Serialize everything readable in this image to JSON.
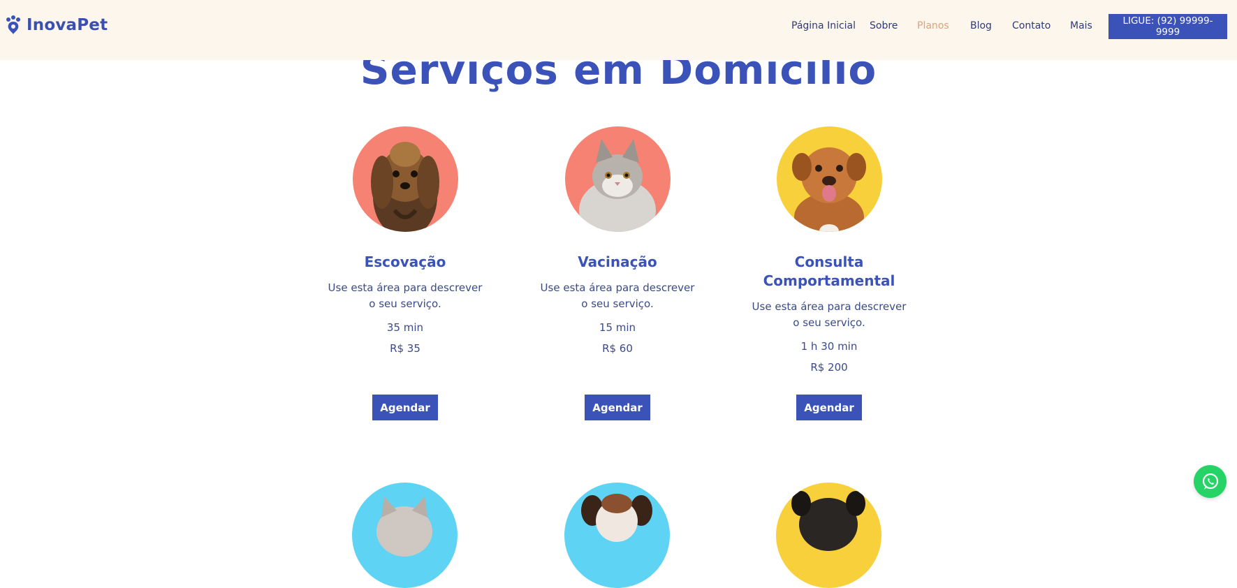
{
  "brand": {
    "name": "InovaPet",
    "icon": "paw-icon",
    "color": "#3b53b8"
  },
  "nav": {
    "items": [
      {
        "label": "Página Inicial"
      },
      {
        "label": "Sobre"
      },
      {
        "label": "Planos",
        "active": true
      },
      {
        "label": "Blog"
      },
      {
        "label": "Contato"
      },
      {
        "label": "Mais"
      }
    ],
    "call_button": "LIGUE: (92) 99999-9999"
  },
  "page_title": "Serviços em Domicílio",
  "services": [
    {
      "title": "Escovação",
      "desc_line1": "Use esta área para descrever",
      "desc_line2": "o seu serviço.",
      "duration": "35 min",
      "price": "R$ 35",
      "button": "Agendar",
      "bg_color": "#f58272",
      "pet": "yorkshire-dog"
    },
    {
      "title": "Vacinação",
      "desc_line1": "Use esta área para descrever",
      "desc_line2": "o seu serviço.",
      "duration": "15 min",
      "price": "R$ 60",
      "button": "Agendar",
      "bg_color": "#f58272",
      "pet": "grey-cat"
    },
    {
      "title_line1": "Consulta",
      "title_line2": "Comportamental",
      "desc_line1": "Use esta área para descrever",
      "desc_line2": "o seu serviço.",
      "duration": "1 h 30 min",
      "price": "R$ 200",
      "button": "Agendar",
      "bg_color": "#f8d03c",
      "pet": "mastiff-puppy"
    }
  ],
  "next_row_colors": [
    "#5fd3f3",
    "#5fd3f3",
    "#f8d03c"
  ],
  "whatsapp": {
    "icon": "whatsapp-icon",
    "color": "#25d366"
  },
  "colors": {
    "accent": "#3b53b8",
    "header_bg": "#fdf6ec",
    "active_nav": "#e0a07a"
  }
}
